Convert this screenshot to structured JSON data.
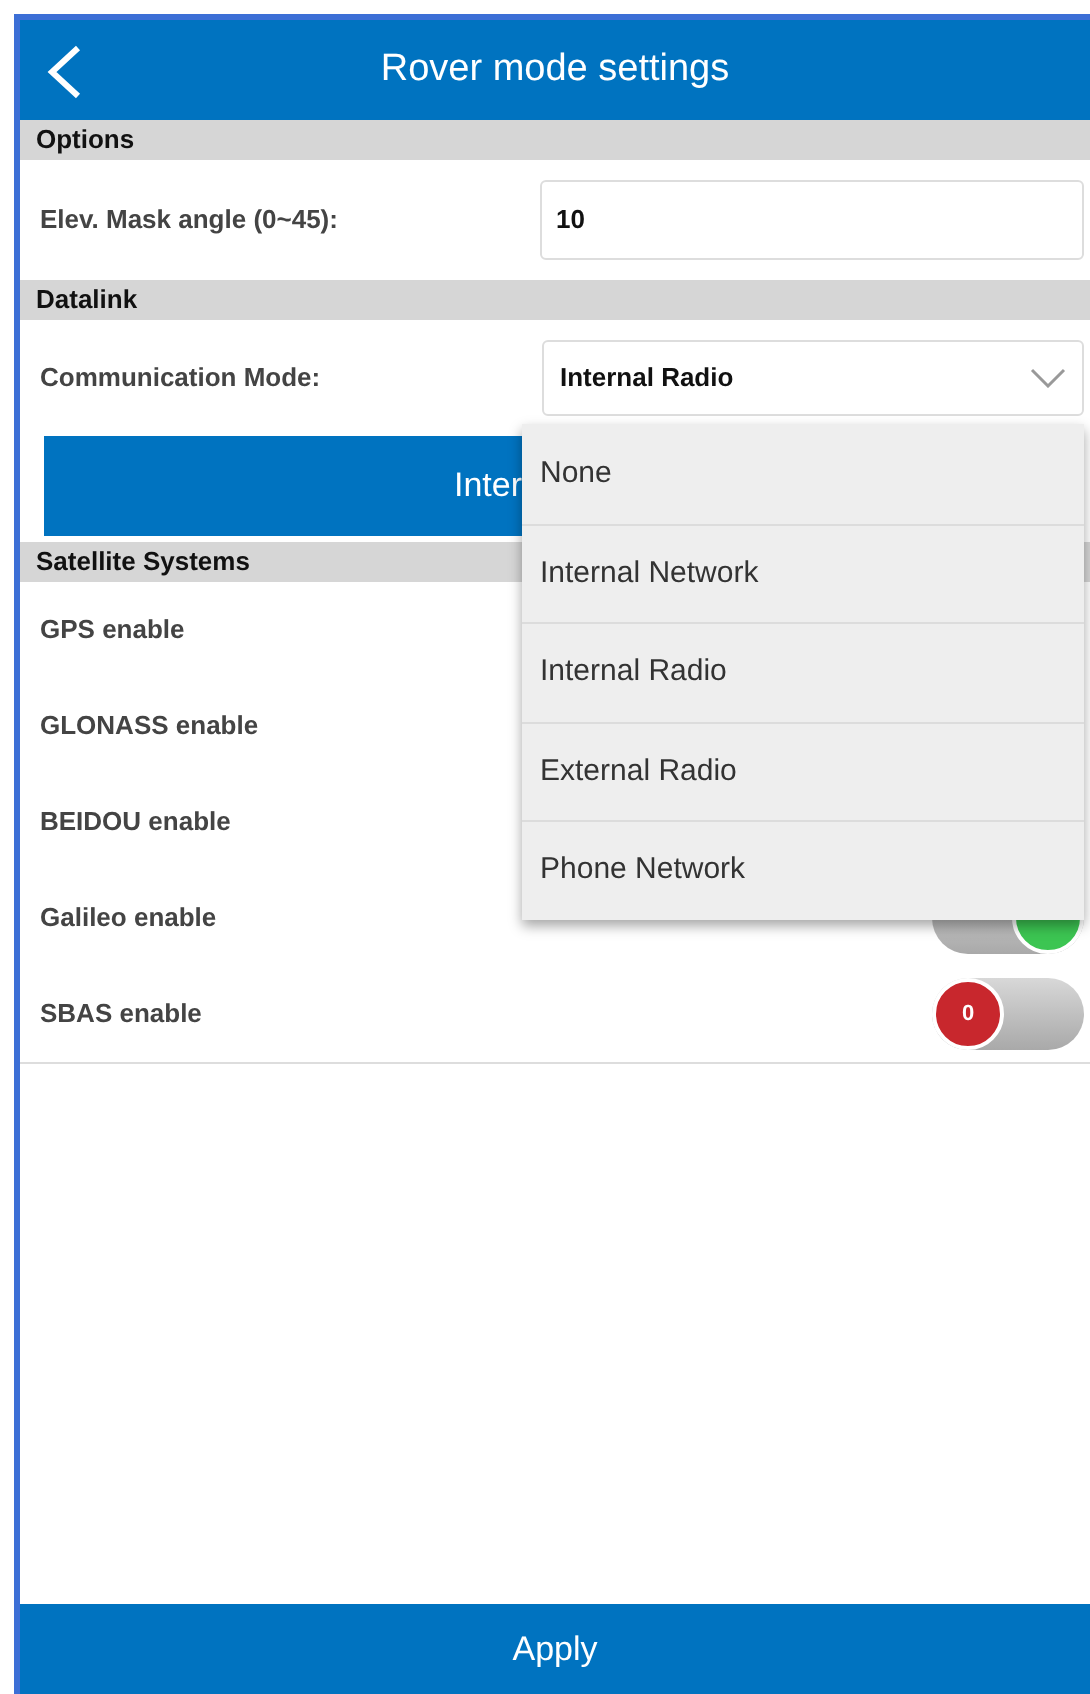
{
  "header": {
    "title": "Rover mode settings"
  },
  "sections": [
    {
      "title": "Options",
      "rows": [
        {
          "kind": "input",
          "label": "Elev. Mask angle (0~45):",
          "value": "10"
        }
      ]
    },
    {
      "title": "Datalink",
      "rows": [
        {
          "kind": "select",
          "label": "Communication Mode:",
          "value": "Internal Radio"
        },
        {
          "kind": "button",
          "label": "Inter"
        }
      ]
    },
    {
      "title": "Satellite Systems",
      "rows": [
        {
          "kind": "switch",
          "label": "GPS enable"
        },
        {
          "kind": "switch",
          "label": "GLONASS enable"
        },
        {
          "kind": "switch",
          "label": "BEIDOU enable"
        },
        {
          "kind": "switch",
          "label": "Galileo enable",
          "toggle": {
            "on": true
          }
        },
        {
          "kind": "switch",
          "label": "SBAS enable",
          "toggle": {
            "on": false,
            "text": "0"
          }
        }
      ]
    }
  ],
  "dropdown": {
    "options": [
      {
        "label": "None",
        "selected": false
      },
      {
        "label": "Internal Network",
        "selected": false
      },
      {
        "label": "Internal Radio",
        "selected": false
      },
      {
        "label": "External Radio",
        "selected": false
      },
      {
        "label": "Phone Network",
        "selected": false
      }
    ]
  },
  "footer": {
    "button": "Apply"
  }
}
